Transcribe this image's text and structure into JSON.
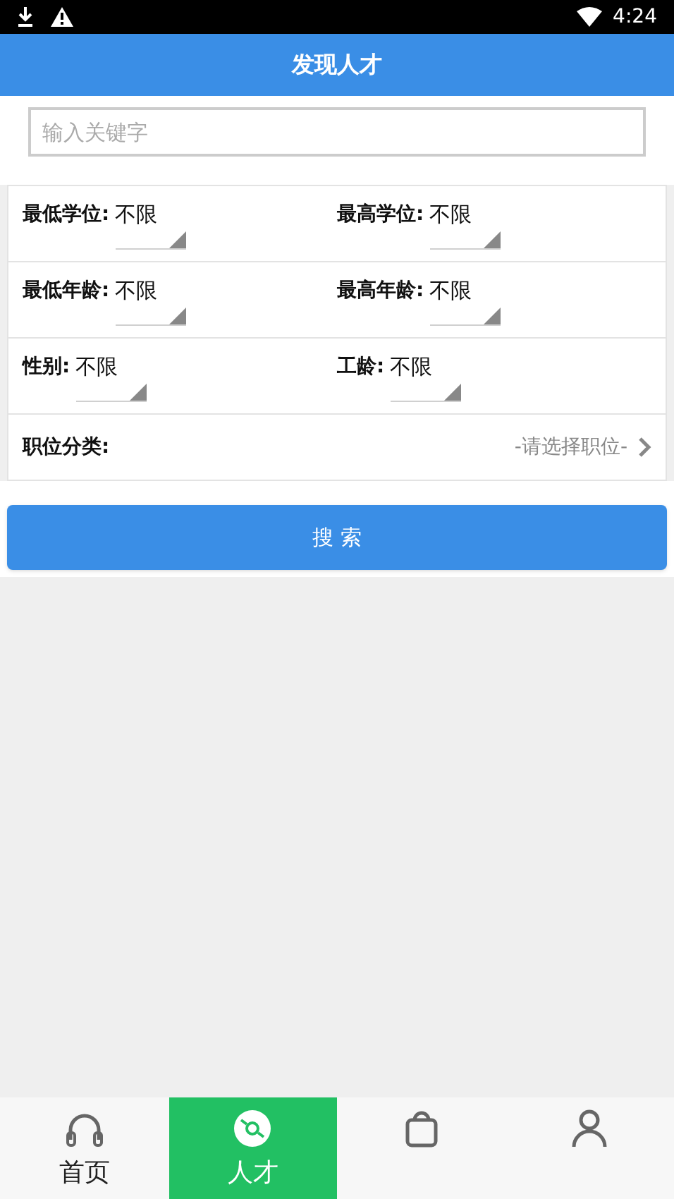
{
  "status_bar": {
    "time": "4:24"
  },
  "header": {
    "title": "发现人才"
  },
  "search": {
    "placeholder": "输入关键字"
  },
  "filters": [
    {
      "label": "最低学位:",
      "value": "不限"
    },
    {
      "label": "最高学位:",
      "value": "不限"
    },
    {
      "label": "最低年龄:",
      "value": "不限"
    },
    {
      "label": "最高年龄:",
      "value": "不限"
    },
    {
      "label": "性别:",
      "value": "不限"
    },
    {
      "label": "工龄:",
      "value": "不限"
    }
  ],
  "position": {
    "label": "职位分类:",
    "value": "-请选择职位-"
  },
  "search_button": {
    "label": "搜 索"
  },
  "nav": [
    {
      "kind": "headphones",
      "label": "首页",
      "selected": false
    },
    {
      "kind": "disc",
      "label": "人才",
      "selected": true
    },
    {
      "kind": "bag",
      "selected": false
    },
    {
      "kind": "person",
      "selected": false
    }
  ]
}
